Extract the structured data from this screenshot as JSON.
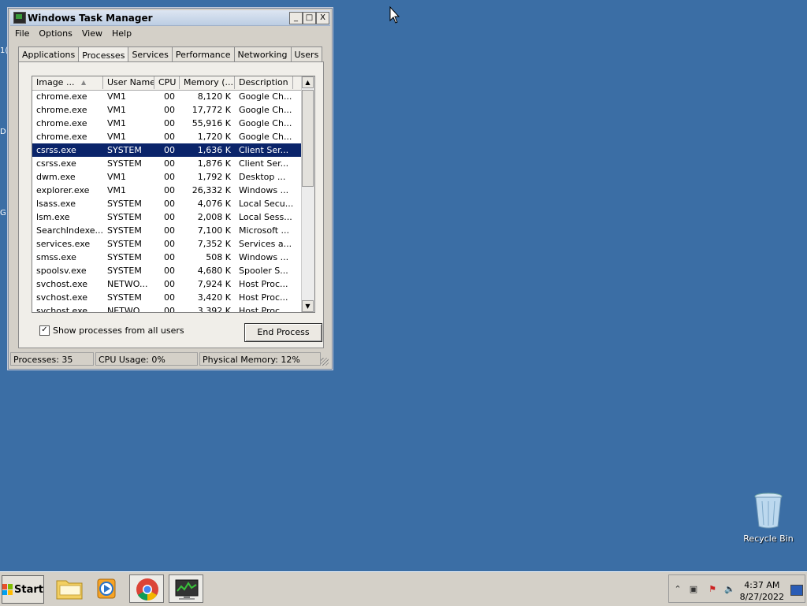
{
  "window": {
    "title": "Windows Task Manager",
    "controls": {
      "minimize": "_",
      "maximize": "□",
      "close": "X"
    },
    "menu": [
      "File",
      "Options",
      "View",
      "Help"
    ],
    "tabs": [
      "Applications",
      "Processes",
      "Services",
      "Performance",
      "Networking",
      "Users"
    ],
    "active_tab": "Processes"
  },
  "process_list": {
    "columns": [
      "Image ...",
      "User Name",
      "CPU",
      "Memory (...",
      "Description"
    ],
    "sort_column": "Image ...",
    "selected_row": 4,
    "rows": [
      [
        "chrome.exe",
        "VM1",
        "00",
        "8,120 K",
        "Google Ch..."
      ],
      [
        "chrome.exe",
        "VM1",
        "00",
        "17,772 K",
        "Google Ch..."
      ],
      [
        "chrome.exe",
        "VM1",
        "00",
        "55,916 K",
        "Google Ch..."
      ],
      [
        "chrome.exe",
        "VM1",
        "00",
        "1,720 K",
        "Google Ch..."
      ],
      [
        "csrss.exe",
        "SYSTEM",
        "00",
        "1,636 K",
        "Client Ser..."
      ],
      [
        "csrss.exe",
        "SYSTEM",
        "00",
        "1,876 K",
        "Client Ser..."
      ],
      [
        "dwm.exe",
        "VM1",
        "00",
        "1,792 K",
        "Desktop ..."
      ],
      [
        "explorer.exe",
        "VM1",
        "00",
        "26,332 K",
        "Windows ..."
      ],
      [
        "lsass.exe",
        "SYSTEM",
        "00",
        "4,076 K",
        "Local Secu..."
      ],
      [
        "lsm.exe",
        "SYSTEM",
        "00",
        "2,008 K",
        "Local Sess..."
      ],
      [
        "SearchIndexe...",
        "SYSTEM",
        "00",
        "7,100 K",
        "Microsoft ..."
      ],
      [
        "services.exe",
        "SYSTEM",
        "00",
        "7,352 K",
        "Services a..."
      ],
      [
        "smss.exe",
        "SYSTEM",
        "00",
        "508 K",
        "Windows ..."
      ],
      [
        "spoolsv.exe",
        "SYSTEM",
        "00",
        "4,680 K",
        "Spooler S..."
      ],
      [
        "svchost.exe",
        "NETWO...",
        "00",
        "7,924 K",
        "Host Proc..."
      ],
      [
        "svchost.exe",
        "SYSTEM",
        "00",
        "3,420 K",
        "Host Proc..."
      ],
      [
        "svchost.exe",
        "NETWO...",
        "00",
        "3,392 K",
        "Host Proc..."
      ]
    ]
  },
  "show_all_users": {
    "label": "Show processes from all users",
    "checked": true
  },
  "end_process_label": "End Process",
  "status": {
    "processes": "Processes: 35",
    "cpu": "CPU Usage: 0%",
    "memory": "Physical Memory: 12%"
  },
  "desktop": {
    "recycle_bin_label": "Recycle Bin",
    "edge_letters": [
      "1(",
      "D",
      "G"
    ]
  },
  "taskbar": {
    "start_label": "Start",
    "clock_time": "4:37 AM",
    "clock_date": "8/27/2022",
    "items": [
      "folder-icon",
      "media-player-icon",
      "chrome-icon",
      "task-manager-icon"
    ]
  }
}
